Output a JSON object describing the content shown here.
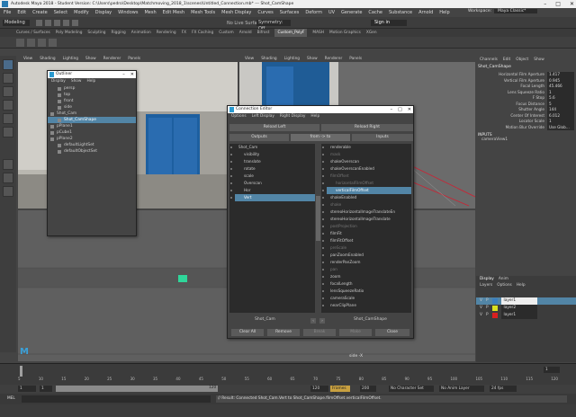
{
  "title_bar": {
    "text": "Autodesk Maya 2018 - Student Version: C:\\Users\\pedro\\Desktop\\Matchmoving_2018_1\\scenes\\Untitled_Connection.mb* --- Shot_CamShape"
  },
  "menubar": {
    "items": [
      "File",
      "Edit",
      "Create",
      "Select",
      "Modify",
      "Display",
      "Windows",
      "Mesh",
      "Edit Mesh",
      "Mesh Tools",
      "Mesh Display",
      "Curves",
      "Surfaces",
      "Deform",
      "UV",
      "Generate",
      "Cache",
      "Substance",
      "Arnold",
      "Help"
    ],
    "workspace_label": "Workspace:",
    "workspace_value": "Maya Classic*"
  },
  "statusline": {
    "mode": "Modeling",
    "live_surface": "No Live Surface",
    "symmetry": "Symmetry: Off",
    "sign_in": "Sign in"
  },
  "shelf_tabs": [
    "Curves / Surfaces",
    "Poly Modeling",
    "Sculpting",
    "Rigging",
    "Animation",
    "Rendering",
    "FX",
    "FX Caching",
    "Custom",
    "Arnold",
    "Bifrost",
    "Custom_PolyF",
    "MASH",
    "Motion Graphics",
    "XGen"
  ],
  "viewport": {
    "menu": [
      "View",
      "Shading",
      "Lighting",
      "Show",
      "Renderer",
      "Panels"
    ],
    "camera_label": "side -X"
  },
  "outliner": {
    "title": "Outliner",
    "menu": [
      "Display",
      "Show",
      "Help"
    ],
    "items": [
      {
        "label": "persp",
        "selected": false,
        "indent": 1
      },
      {
        "label": "top",
        "selected": false,
        "indent": 1
      },
      {
        "label": "front",
        "selected": false,
        "indent": 1
      },
      {
        "label": "side",
        "selected": false,
        "indent": 1
      },
      {
        "label": "Shot_Cam",
        "selected": false,
        "indent": 0
      },
      {
        "label": "Shot_CamShape",
        "selected": true,
        "indent": 1
      },
      {
        "label": "pPlane1",
        "selected": false,
        "indent": 0
      },
      {
        "label": "pCube1",
        "selected": false,
        "indent": 0
      },
      {
        "label": "pPlane2",
        "selected": false,
        "indent": 0
      },
      {
        "label": "defaultLightSet",
        "selected": false,
        "indent": 1
      },
      {
        "label": "defaultObjectSet",
        "selected": false,
        "indent": 1
      }
    ]
  },
  "connection_editor": {
    "title": "Connection Editor",
    "menu": [
      "Options",
      "Left Display",
      "Right Display",
      "Help"
    ],
    "reload_left": "Reload Left",
    "reload_right": "Reload Right",
    "outputs_label": "Outputs",
    "direction_label": "from -> to",
    "inputs_label": "Inputs",
    "left_items": [
      {
        "label": "Shot_Cam",
        "state": "normal",
        "sub": false
      },
      {
        "label": "visibility",
        "state": "normal",
        "sub": true
      },
      {
        "label": "translate",
        "state": "normal",
        "sub": true
      },
      {
        "label": "rotate",
        "state": "normal",
        "sub": true
      },
      {
        "label": "scale",
        "state": "normal",
        "sub": true
      },
      {
        "label": "Overscan",
        "state": "normal",
        "sub": true
      },
      {
        "label": "Hor",
        "state": "normal",
        "sub": true
      },
      {
        "label": "Vert",
        "state": "selected",
        "sub": true
      }
    ],
    "right_items": [
      {
        "label": "renderable",
        "state": "normal",
        "sub": false
      },
      {
        "label": "mask",
        "state": "dim",
        "sub": false
      },
      {
        "label": "shakeOverscan",
        "state": "normal",
        "sub": false
      },
      {
        "label": "shakeOverscanEnabled",
        "state": "normal",
        "sub": false
      },
      {
        "label": "filmOffset",
        "state": "dim",
        "sub": false
      },
      {
        "label": "horizontalFilmOffset",
        "state": "dim",
        "sub": true
      },
      {
        "label": "verticalFilmOffset",
        "state": "selected",
        "sub": true
      },
      {
        "label": "shakeEnabled",
        "state": "normal",
        "sub": false
      },
      {
        "label": "shake",
        "state": "dim",
        "sub": false
      },
      {
        "label": "stereoHorizontalImageTranslateEn",
        "state": "normal",
        "sub": false
      },
      {
        "label": "stereoHorizontalImageTranslate",
        "state": "normal",
        "sub": false
      },
      {
        "label": "postProjection",
        "state": "dim",
        "sub": false
      },
      {
        "label": "filmFit",
        "state": "normal",
        "sub": false
      },
      {
        "label": "filmFitOffset",
        "state": "normal",
        "sub": false
      },
      {
        "label": "preScale",
        "state": "dim",
        "sub": false
      },
      {
        "label": "panZoomEnabled",
        "state": "normal",
        "sub": false
      },
      {
        "label": "renderPanZoom",
        "state": "normal",
        "sub": false
      },
      {
        "label": "pan",
        "state": "dim",
        "sub": false
      },
      {
        "label": "zoom",
        "state": "normal",
        "sub": false
      },
      {
        "label": "focalLength",
        "state": "normal",
        "sub": false
      },
      {
        "label": "lensSqueezeRatio",
        "state": "normal",
        "sub": false
      },
      {
        "label": "cameraScale",
        "state": "normal",
        "sub": false
      },
      {
        "label": "nearClipPlane",
        "state": "normal",
        "sub": false
      }
    ],
    "left_node": "Shot_Cam",
    "right_node": "Shot_CamShape",
    "buttons": {
      "clear_all": "Clear All",
      "remove": "Remove",
      "break": "Break",
      "make": "Make",
      "close": "Close"
    }
  },
  "channel_box": {
    "menu": [
      "Channels",
      "Edit",
      "Object",
      "Show"
    ],
    "object": "Shot_CamShape",
    "attrs": [
      {
        "name": "Horizontal Film Aperture",
        "value": "1.417"
      },
      {
        "name": "Vertical Film Aperture",
        "value": "0.945"
      },
      {
        "name": "Focal Length",
        "value": "45.466"
      },
      {
        "name": "Lens Squeeze Ratio",
        "value": "1"
      },
      {
        "name": "F Stop",
        "value": "5.6"
      },
      {
        "name": "Focus Distance",
        "value": "5"
      },
      {
        "name": "Shutter Angle",
        "value": "144"
      },
      {
        "name": "Center Of Interest",
        "value": "6.012"
      },
      {
        "name": "Locator Scale",
        "value": "1"
      },
      {
        "name": "Motion Blur Override",
        "value": "Use Glob..."
      }
    ],
    "inputs_label": "INPUTS",
    "inputs_item": "cameraView1"
  },
  "layers": {
    "tabs": [
      "Display",
      "Anim"
    ],
    "menu": [
      "Layers",
      "Options",
      "Help"
    ],
    "items": [
      {
        "name": "layer1",
        "v": "V",
        "p": "P",
        "color": "#3a7fbf",
        "selected": true
      },
      {
        "name": "layer2",
        "v": "V",
        "p": "P",
        "color": "#d8e020",
        "selected": false
      },
      {
        "name": "layer1",
        "v": "V",
        "p": "P",
        "color": "#d82020",
        "selected": false
      }
    ]
  },
  "timeline": {
    "ticks": [
      "5",
      "10",
      "15",
      "20",
      "25",
      "30",
      "35",
      "40",
      "45",
      "50",
      "55",
      "60",
      "65",
      "70",
      "75",
      "80",
      "85",
      "90",
      "95",
      "100",
      "105",
      "110",
      "115",
      "120"
    ],
    "current_frame": "1"
  },
  "range": {
    "start": "1",
    "range_start": "1",
    "range_end": "120",
    "end": "120",
    "end2": "200",
    "fps_label": "Frames 30",
    "char_set": "No Character Set",
    "anim_layer": "No Anim Layer",
    "fps": "24 fps"
  },
  "command_line": {
    "label": "MEL",
    "result": "// Result: Connected Shot_Cam.Vert to Shot_CamShape.filmOffset.verticalFilmOffset."
  }
}
